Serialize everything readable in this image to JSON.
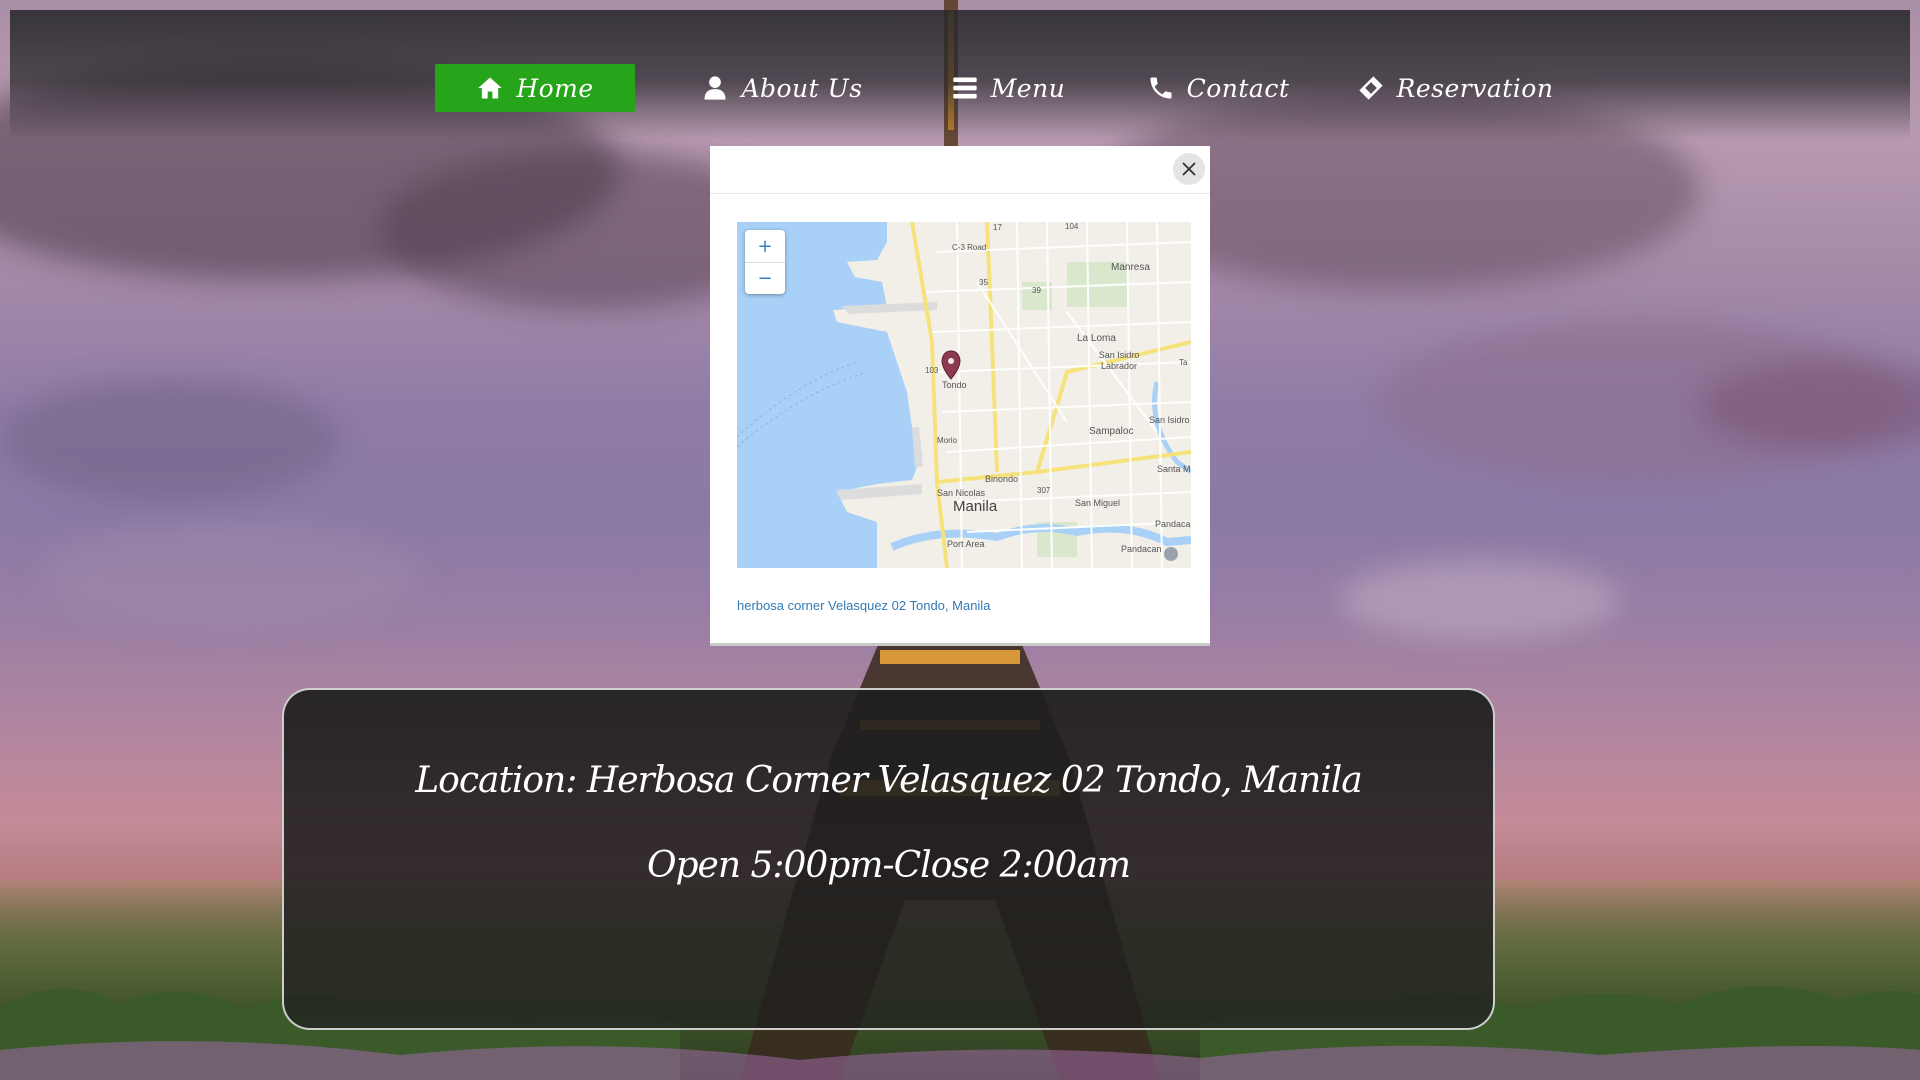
{
  "nav": {
    "items": [
      {
        "label": "Home",
        "icon": "home-icon",
        "active": true
      },
      {
        "label": "About Us",
        "icon": "user-icon",
        "active": false
      },
      {
        "label": "Menu",
        "icon": "menu-icon",
        "active": false
      },
      {
        "label": "Contact",
        "icon": "phone-icon",
        "active": false
      },
      {
        "label": "Reservation",
        "icon": "ticket-icon",
        "active": false
      }
    ]
  },
  "modal": {
    "close_icon": "close-icon",
    "address_link": "herbosa corner Velasquez 02 Tondo, Manila",
    "map": {
      "zoom_in": "+",
      "zoom_out": "−",
      "city_label": "Manila",
      "place_labels": {
        "manresa": "Manresa",
        "la_loma": "La Loma",
        "san_isidro_labrador": "San Isidro Labrador",
        "sampaloc": "Sampaloc",
        "san_isidro": "San Isidro",
        "santa_mesa": "Santa M",
        "binondo": "Binondo",
        "san_nicolas": "San Nicolas",
        "san_miguel": "San Miguel",
        "port_area": "Port Area",
        "pandacan": "Pandacan",
        "pandacar": "Pandacar",
        "tondo": "Tondo",
        "moriones": "Morio",
        "c3_road": "C-3 Road",
        "r17": "17",
        "r104": "104",
        "r35": "35",
        "r39": "39",
        "r103": "103",
        "r307": "307",
        "t_label": "Ta"
      },
      "info_icon": "i"
    }
  },
  "info": {
    "location": "Location: Herbosa Corner Velasquez 02 Tondo, Manila",
    "hours": "Open 5:00pm-Close 2:00am"
  },
  "colors": {
    "nav_active": "#26a51a",
    "link": "#337ab7",
    "map_water": "#a9d1f7",
    "map_land": "#f2efe9",
    "pin": "#8b3a52"
  }
}
